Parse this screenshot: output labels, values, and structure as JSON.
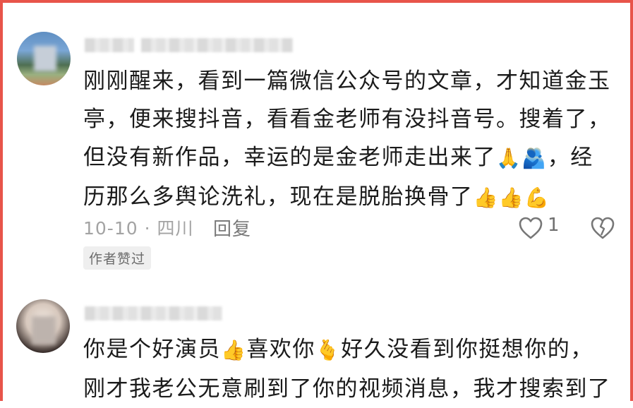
{
  "comments": [
    {
      "username": "",
      "lines": [
        "刚刚醒来，看到一篇微信公众号的文章，才知道金玉",
        "亭，便来搜抖音，看看金老师有没抖音号。搜着了，",
        "但没有新作品，幸运的是金老师走出来了",
        "，经",
        "历那么多舆论洗礼，现在是脱胎换骨了"
      ],
      "emoji_line3": "🙏🫂",
      "emoji_line4": "👍👍💪",
      "date_location": "10-10 · 四川",
      "reply_label": "回复",
      "like_count": "1",
      "author_badge": "作者赞过"
    },
    {
      "username": "",
      "line1_a": "你是个好演员",
      "line1_b": "喜欢你",
      "line1_c": "好久没看到你挺想你的，",
      "line2": "刚才我老公无意刷到了你的视频消息，我才搜索到了",
      "emoji_a": "👍",
      "emoji_b": "🫰"
    }
  ],
  "icons": {
    "like": "heart-outline-icon",
    "dislike": "broken-heart-icon"
  },
  "colors": {
    "frame": "#e8544a",
    "text": "#1b1b1b",
    "meta": "#a3a3a3"
  }
}
